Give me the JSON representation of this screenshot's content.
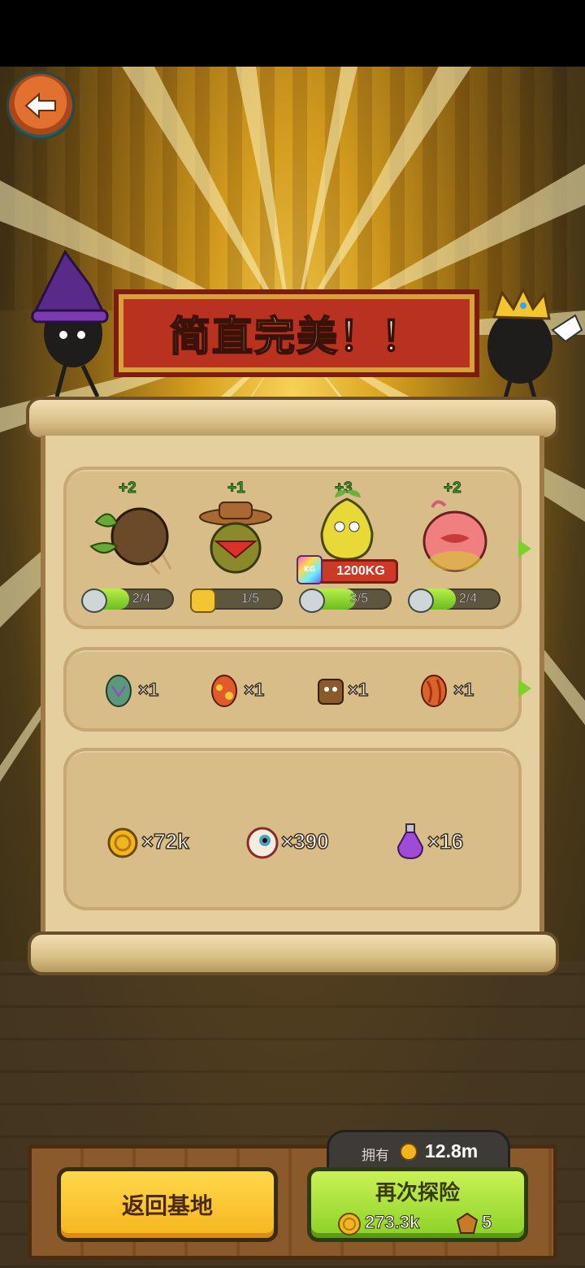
{
  "banner": {
    "title": "简直完美！！"
  },
  "monsters": [
    {
      "name": "crab-monster",
      "bonus": "+2",
      "level": "2/4",
      "progress": 0.5,
      "icon": "horned-skull-icon"
    },
    {
      "name": "cowboy-monster",
      "bonus": "+1",
      "level": "1/5",
      "progress": 0.2,
      "icon": "gold-horned-icon"
    },
    {
      "name": "pear-monster",
      "bonus": "+3",
      "level": "3/5",
      "progress": 0.6,
      "icon": "horned-skull-icon",
      "weight": "1200KG",
      "weight_icon_label": "KG"
    },
    {
      "name": "peach-monster",
      "bonus": "+2",
      "level": "2/4",
      "progress": 0.5,
      "icon": "horned-skull-icon"
    }
  ],
  "items": [
    {
      "name": "green-egg",
      "count": "×1",
      "color": "#5a9a7a"
    },
    {
      "name": "red-yellow-egg",
      "count": "×1",
      "color": "#e05a2a"
    },
    {
      "name": "wooden-creature",
      "count": "×1",
      "color": "#8a5a2a"
    },
    {
      "name": "lava-egg",
      "count": "×1",
      "color": "#d8642a"
    }
  ],
  "resources": [
    {
      "name": "gold-coin",
      "count": "×72k"
    },
    {
      "name": "eyeball",
      "count": "×390"
    },
    {
      "name": "purple-potion",
      "count": "×16"
    }
  ],
  "owned": {
    "label": "拥有",
    "value": "12.8m"
  },
  "buttons": {
    "home_label": "返回基地",
    "again_label": "再次探险",
    "cost_coins": "273.3k",
    "cost_tickets": "5"
  },
  "colors": {
    "banner": "#b8321f",
    "accent_green": "#8bd126",
    "accent_yellow": "#f6b51e"
  }
}
